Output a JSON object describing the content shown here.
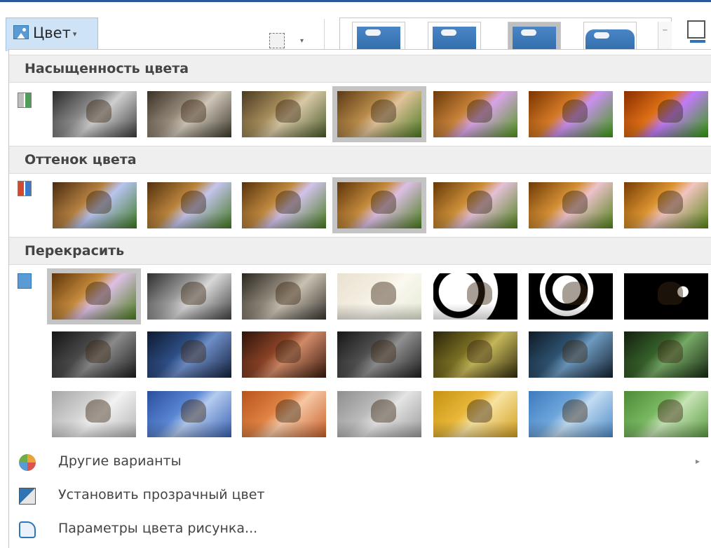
{
  "ribbon": {
    "color_button_label": "Цвет",
    "color_button_caret": "▾",
    "compress_caret": "▾",
    "gallery_scroll_symbol": "−"
  },
  "sections": {
    "saturation": {
      "title": "Насыщенность цвета"
    },
    "tone": {
      "title": "Оттенок цвета"
    },
    "recolor": {
      "title": "Перекрасить"
    }
  },
  "menu": {
    "more_variants": "Другие варианты",
    "more_variants_arrow": "▸",
    "set_transparent": "Установить прозрачный цвет",
    "picture_color_options": "Параметры цвета рисунка..."
  },
  "icons": {
    "color": "picture-icon",
    "compress": "compress-pictures-icon",
    "saturation": "saturation-icon",
    "tone": "color-tone-icon",
    "recolor": "recolor-icon",
    "more_variants": "color-palette-icon",
    "set_transparent": "transparent-color-icon",
    "picture_color_options": "picture-color-options-icon"
  },
  "colors": {
    "accent": "#2b579a",
    "selected_button": "#cfe3f7",
    "section_header": "#efefef"
  },
  "gallery": {
    "saturation_selected_index": 3,
    "tone_selected_index": 3,
    "recolor_selected_index": 0,
    "style_selected_index": 2
  }
}
